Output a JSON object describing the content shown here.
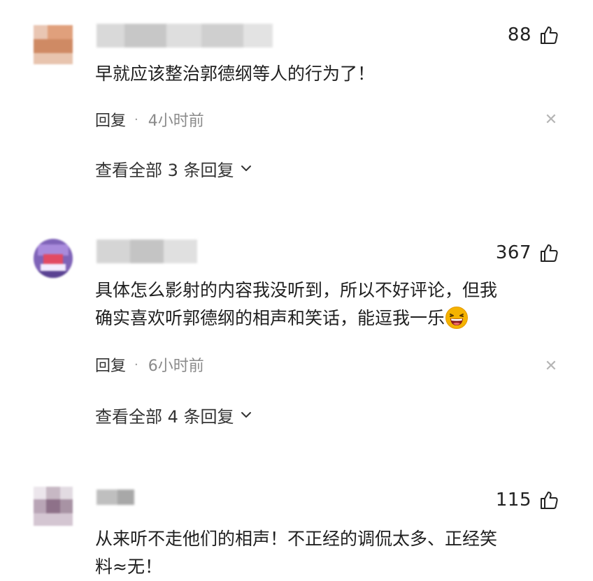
{
  "comments": [
    {
      "likes": "88",
      "text": "早就应该整治郭德纲等人的行为了！",
      "reply_label": "回复",
      "time": "4小时前",
      "view_replies": "查看全部 3 条回复"
    },
    {
      "likes": "367",
      "text": "具体怎么影射的内容我没听到，所以不好评论，但我\n确实喜欢听郭德纲的相声和笑话，能逗我一乐",
      "reply_label": "回复",
      "time": "6小时前",
      "view_replies": "查看全部 4 条回复"
    },
    {
      "likes": "115",
      "text": "从来听不走他们的相声！不正经的调侃太多、正经笑\n料≈无！"
    }
  ],
  "icons": {
    "like": "thumbs-up-icon",
    "close": "close-icon",
    "expand": "chevron-down-icon",
    "emoji": "laughing-emoji-icon"
  },
  "colors": {
    "text": "#1f1f1f",
    "meta": "#8a8a8a",
    "close": "#b5b5b5",
    "emoji": "#f5b300"
  }
}
